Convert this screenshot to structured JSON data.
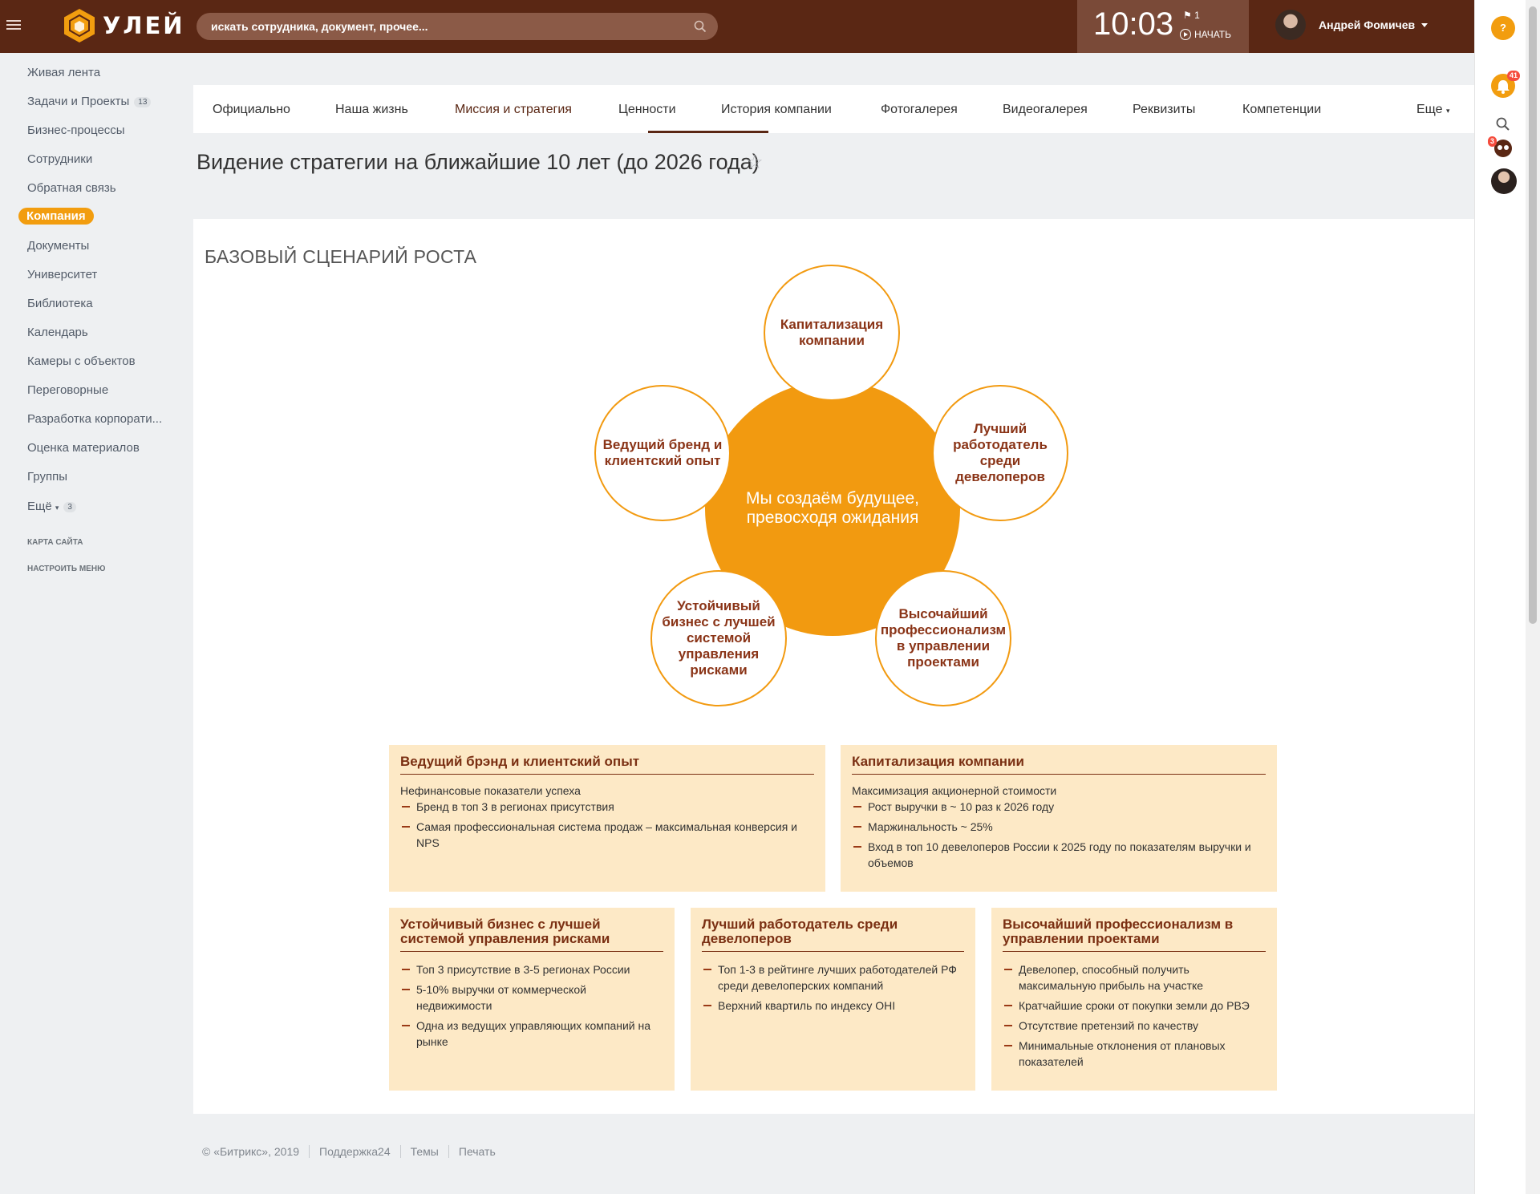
{
  "header": {
    "logo_text": "УЛЕЙ",
    "search_placeholder": "искать сотрудника, документ, прочее...",
    "clock": "10:03",
    "flag_count": "1",
    "start_label": "НАЧАТЬ",
    "user_name": "Андрей Фомичев",
    "accent_color": "#5a2714"
  },
  "right_panel": {
    "help_label": "?",
    "notifications_count": "41",
    "chat_count": "3"
  },
  "left_menu": {
    "items": [
      {
        "label": "Живая лента"
      },
      {
        "label": "Задачи и Проекты",
        "count": "13"
      },
      {
        "label": "Бизнес-процессы"
      },
      {
        "label": "Сотрудники"
      },
      {
        "label": "Обратная связь"
      },
      {
        "label": "Компания",
        "active": true
      },
      {
        "label": "Документы"
      },
      {
        "label": "Университет"
      },
      {
        "label": "Библиотека"
      },
      {
        "label": "Календарь"
      },
      {
        "label": "Камеры с объектов"
      },
      {
        "label": "Переговорные"
      },
      {
        "label": "Разработка корпорати..."
      },
      {
        "label": "Оценка материалов"
      },
      {
        "label": "Группы"
      },
      {
        "label": "Ещё",
        "count": "3"
      }
    ],
    "sitemap": "КАРТА САЙТА",
    "configure": "НАСТРОИТЬ МЕНЮ"
  },
  "tabs": {
    "items": [
      "Официально",
      "Наша жизнь",
      "Миссия и стратегия",
      "Ценности",
      "История компании",
      "Фотогалерея",
      "Видеогалерея",
      "Реквизиты",
      "Компетенции"
    ],
    "active": "Миссия и стратегия",
    "more": "Еще"
  },
  "page": {
    "title": "Видение стратегии на ближайшие 10 лет (до 2026 года)",
    "star": "☆"
  },
  "diagram": {
    "section_title": "БАЗОВЫЙ СЦЕНАРИЙ РОСТА",
    "center": "Мы создаём будущее, превосходя ожидания",
    "top": "Капитализация компании",
    "left": "Ведущий бренд и клиентский опыт",
    "right": "Лучший работодатель среди девелоперов",
    "bottom_left": "Устойчивый бизнес с лучшей системой управления рисками",
    "bottom_right": "Высочайший профессионализм в управлении проектами",
    "accent_color": "#f29a10"
  },
  "cards": {
    "brand": {
      "title": "Ведущий брэнд и клиентский опыт",
      "subtitle": "Нефинансовые показатели успеха",
      "items": [
        "Бренд в топ 3 в регионах присутствия",
        "Самая профессиональная система продаж – максимальная конверсия и NPS"
      ]
    },
    "capital": {
      "title": "Капитализация компании",
      "subtitle": "Максимизация акционерной стоимости",
      "items": [
        "Рост выручки в ~ 10 раз к 2026 году",
        "Маржинальность ~ 25%",
        "Вход в топ 10 девелоперов России к 2025 году по показателям выручки и объемов"
      ]
    },
    "risk": {
      "title": "Устойчивый бизнес с лучшей системой управления рисками",
      "items": [
        "Топ 3 присутствие в 3-5 регионах России",
        "5-10% выручки от коммерческой недвижимости",
        "Одна из ведущих управляющих компаний на рынке"
      ]
    },
    "employer": {
      "title": "Лучший работодатель среди девелоперов",
      "items": [
        "Топ 1-3 в рейтинге лучших работодателей РФ среди девелоперских компаний",
        "Верхний квартиль по индексу OHI"
      ]
    },
    "projects": {
      "title": "Высочайший профессионализм в управлении проектами",
      "items": [
        "Девелопер, способный получить максимальную прибыль на участке",
        "Кратчайшие сроки от покупки земли до РВЭ",
        "Отсутствие претензий по качеству",
        "Минимальные отклонения от плановых показателей"
      ]
    }
  },
  "footer": {
    "copyright": "© «Битрикс», 2019",
    "support": "Поддержка24",
    "themes": "Темы",
    "print": "Печать"
  }
}
